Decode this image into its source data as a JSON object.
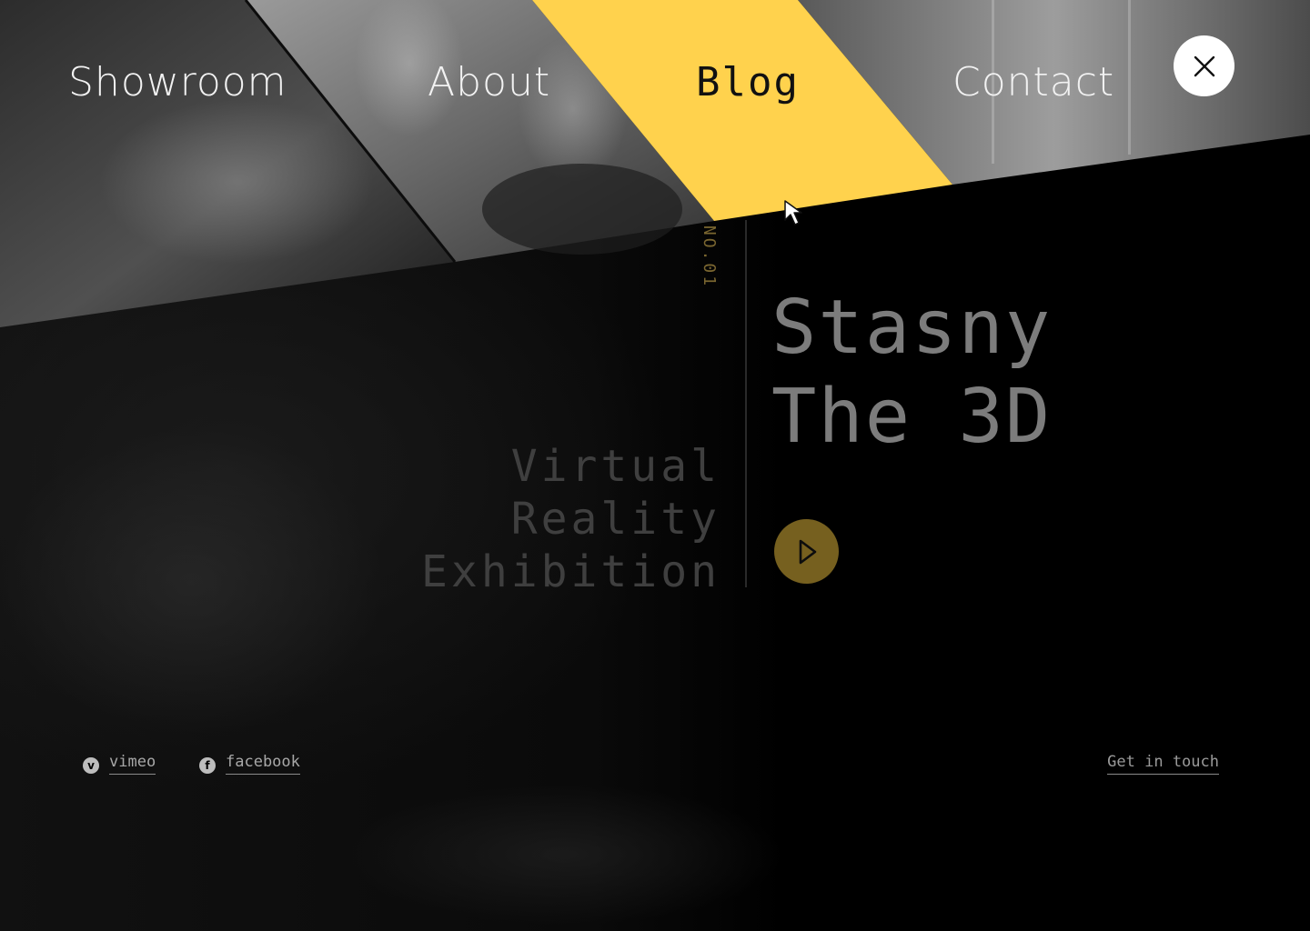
{
  "nav": {
    "items": [
      {
        "label": "Showroom",
        "active": false
      },
      {
        "label": "About",
        "active": false
      },
      {
        "label": "Blog",
        "active": true
      },
      {
        "label": "Contact",
        "active": false
      }
    ],
    "close_icon": "close-icon"
  },
  "hero": {
    "number_label": "NO.01",
    "title_lines": [
      "Stasny",
      "The 3D"
    ],
    "subtitle_lines": [
      "Virtual",
      "Reality",
      "Exhibition"
    ],
    "play_icon": "play-icon"
  },
  "footer": {
    "social": [
      {
        "label": "vimeo",
        "icon": "vimeo-icon",
        "glyph": "v"
      },
      {
        "label": "facebook",
        "icon": "facebook-icon",
        "glyph": "f"
      }
    ],
    "cta": "Get in touch"
  },
  "colors": {
    "accent": "#FFD24D",
    "accent_dim": "#76601F",
    "background": "#000000"
  }
}
